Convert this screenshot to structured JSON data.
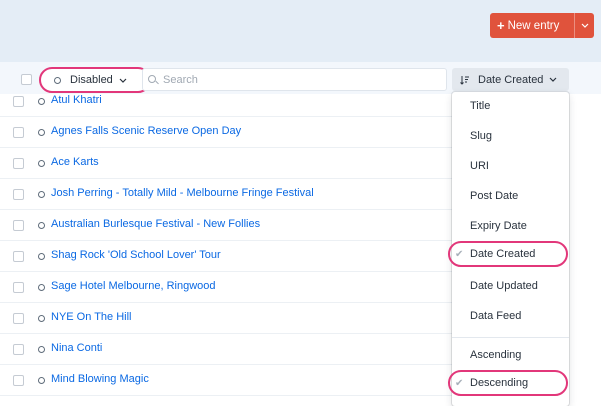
{
  "header": {
    "new_entry_label": "New entry",
    "accent": "#e0533c"
  },
  "toolbar": {
    "status_label": "Disabled",
    "search_placeholder": "Search",
    "sort_label": "Date Created"
  },
  "entries": [
    "Atul Khatri",
    "Agnes Falls Scenic Reserve Open Day",
    "Ace Karts",
    "Josh Perring - Totally Mild - Melbourne Fringe Festival",
    "Australian Burlesque Festival - New Follies",
    "Shag Rock 'Old School Lover' Tour",
    "Sage Hotel Melbourne, Ringwood",
    "NYE On The Hill",
    "Nina Conti",
    "Mind Blowing Magic"
  ],
  "sort_menu": {
    "attributes": [
      "Title",
      "Slug",
      "URI",
      "Post Date",
      "Expiry Date",
      "Date Created",
      "Date Updated",
      "Data Feed"
    ],
    "directions": [
      "Ascending",
      "Descending"
    ],
    "selected_attribute": "Date Created",
    "selected_direction": "Descending"
  }
}
